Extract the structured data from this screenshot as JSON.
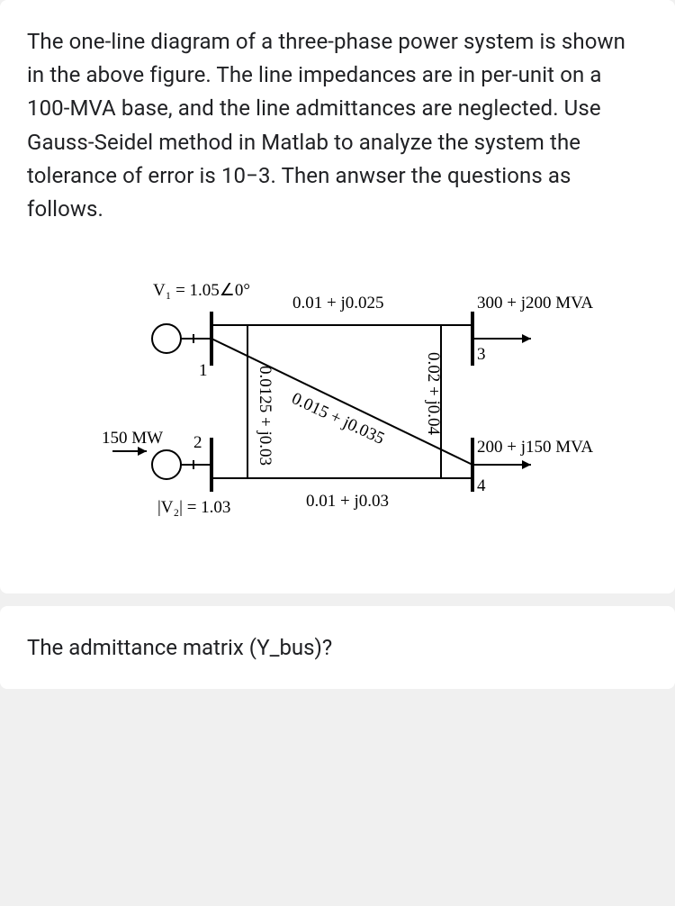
{
  "problem_statement": "The one-line diagram of a three-phase power system is shown in the above figure. The line impedances are in per-unit on a 100-MVA base, and the line admittances are neglected. Use Gauss-Seidel method in Matlab to analyze the system the tolerance of error is 10−3. Then anwser the questions as follows.",
  "diagram": {
    "bus1": {
      "number": "1",
      "voltage": "V₁ = 1.05∠0°"
    },
    "bus2": {
      "number": "2",
      "power_in": "150 MW",
      "voltage_mag": "|V₂| = 1.03"
    },
    "bus3": {
      "number": "3",
      "load": "300 + j200 MVA"
    },
    "bus4": {
      "number": "4",
      "load": "200 + j150 MVA"
    },
    "lines": {
      "l13": "0.01 + j0.025",
      "l12": "0.0125 + j0.03",
      "l14": "0.015 + j0.035",
      "l34": "0.02 + j0.04",
      "l24": "0.01 + j0.03"
    }
  },
  "chart_data": {
    "type": "diagram",
    "description": "One-line diagram of 4-bus power system",
    "buses": [
      {
        "id": 1,
        "type": "slack",
        "V": "1.05∠0°"
      },
      {
        "id": 2,
        "type": "PV",
        "P_gen_MW": 150,
        "V_mag": 1.03
      },
      {
        "id": 3,
        "type": "PQ",
        "load_MVA": "300 + j200"
      },
      {
        "id": 4,
        "type": "PQ",
        "load_MVA": "200 + j150"
      }
    ],
    "lines": [
      {
        "from": 1,
        "to": 3,
        "impedance_pu": "0.01 + j0.025"
      },
      {
        "from": 1,
        "to": 2,
        "impedance_pu": "0.0125 + j0.03"
      },
      {
        "from": 1,
        "to": 4,
        "impedance_pu": "0.015 + j0.035"
      },
      {
        "from": 3,
        "to": 4,
        "impedance_pu": "0.02 + j0.04"
      },
      {
        "from": 2,
        "to": 4,
        "impedance_pu": "0.01 + j0.03"
      }
    ],
    "base_MVA": 100,
    "tolerance": "10-3"
  },
  "question": "The admittance matrix (Y_bus)?"
}
